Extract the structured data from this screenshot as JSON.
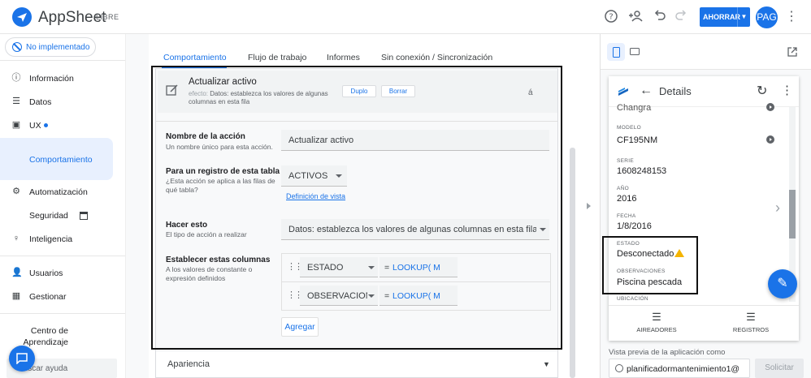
{
  "app": {
    "brand": "AppSheet",
    "plan": "LIBRE",
    "save_label": "AHORRAR",
    "avatar": "PAG"
  },
  "sidebar": {
    "deploy_status": "No implementado",
    "items": [
      {
        "label": "Información",
        "icon": "info-icon"
      },
      {
        "label": "Datos",
        "icon": "table-icon"
      },
      {
        "label": "UX",
        "icon": "ux-icon"
      },
      {
        "label": "Comportamiento",
        "icon": ""
      },
      {
        "label": "Automatización",
        "icon": "automation-icon"
      },
      {
        "label": "Seguridad",
        "icon": "calendar-icon"
      },
      {
        "label": "Inteligencia",
        "icon": "bulb-icon"
      },
      {
        "label": "Usuarios",
        "icon": "person-icon"
      },
      {
        "label": "Gestionar",
        "icon": "manage-icon"
      },
      {
        "label": "Centro de Aprendizaje",
        "icon": ""
      }
    ],
    "search_help": "Buscar ayuda"
  },
  "editor": {
    "tabs": [
      "Comportamiento",
      "Flujo de trabajo",
      "Informes",
      "Sin conexión / Sincronización"
    ],
    "action": {
      "title": "Actualizar activo",
      "effect_prefix": "efecto:",
      "effect_text": "Datos: establezca los valores de algunas columnas en esta fila",
      "duplicate": "Duplo",
      "delete": "Borrar",
      "lang_mark": "á"
    },
    "form": {
      "name_label": "Nombre de la acción",
      "name_hint": "Un nombre único para esta acción.",
      "name_value": "Actualizar activo",
      "table_label": "Para un registro de esta tabla",
      "table_hint": "¿Esta acción se aplica a las filas de qué tabla?",
      "table_value": "ACTIVOS",
      "view_link": "Definición de vista",
      "do_label": "Hacer esto",
      "do_hint": "El tipo de acción a realizar",
      "do_value": "Datos: establezca los valores de algunas columnas en esta fila",
      "set_label": "Establecer estas columnas",
      "set_hint": "A los valores de constante o expresión definidos",
      "rows": [
        {
          "column": "ESTADO",
          "eq": "=",
          "expr": "LOOKUP( M"
        },
        {
          "column": "OBSERVACION",
          "eq": "=",
          "expr": "LOOKUP( M"
        }
      ],
      "add_label": "Agregar"
    },
    "appearance": "Apariencia"
  },
  "preview": {
    "header_title": "Details",
    "fields": [
      {
        "label": "",
        "value": "Changra"
      },
      {
        "label": "MODELO",
        "value": "CF195NM"
      },
      {
        "label": "SERIE",
        "value": "1608248153"
      },
      {
        "label": "AÑO",
        "value": "2016"
      },
      {
        "label": "FECHA",
        "value": "1/8/2016"
      },
      {
        "label": "ESTADO",
        "value": "Desconectado"
      },
      {
        "label": "OBSERVACIONES",
        "value": "Piscina pescada"
      },
      {
        "label": "UBICACIÓN",
        "value": ""
      }
    ],
    "nav": [
      "AIREADORES",
      "REGISTROS"
    ],
    "caption": "Vista previa de la aplicación como",
    "user": "planificadormantenimiento1@",
    "request": "Solicitar"
  }
}
